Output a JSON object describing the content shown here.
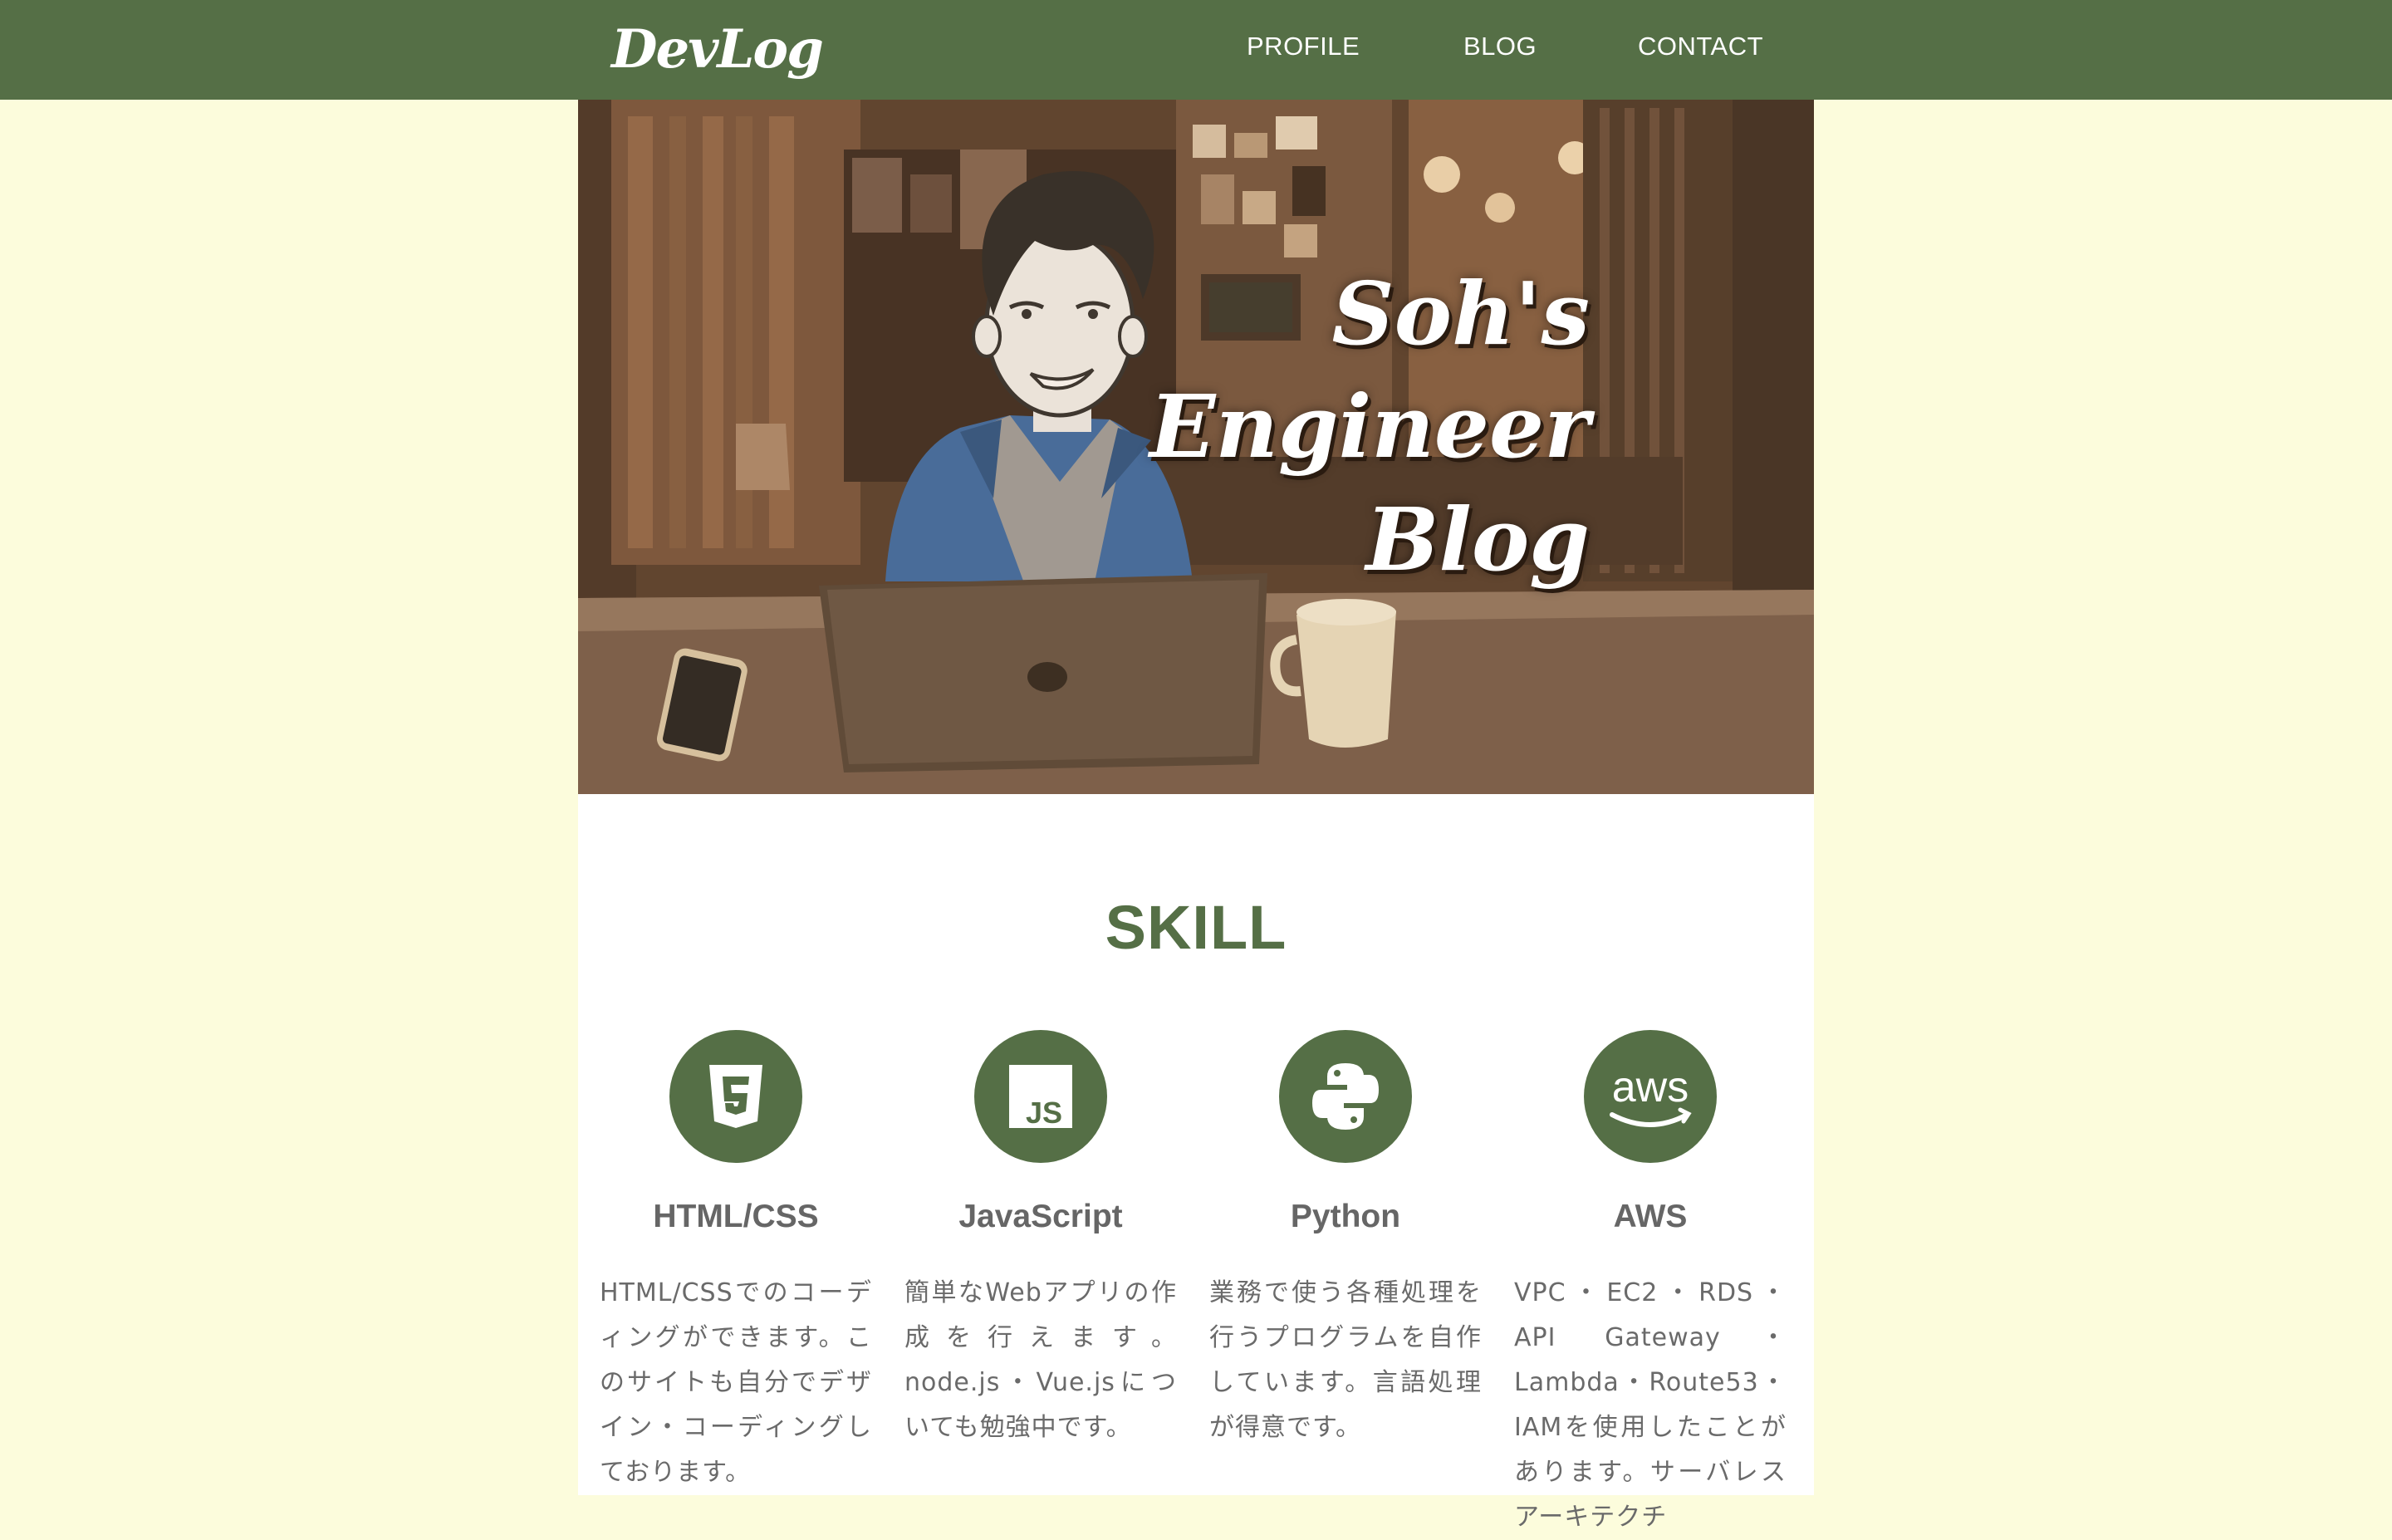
{
  "header": {
    "logo": "DevLog",
    "nav": [
      "PROFILE",
      "BLOG",
      "CONTACT"
    ]
  },
  "hero": {
    "title_lines": [
      "Soh's",
      "Engineer",
      "Blog"
    ]
  },
  "skills": {
    "title": "SKILL",
    "items": [
      {
        "icon": "html5-icon",
        "name": "HTML/CSS",
        "desc": "HTML/CSSでのコーディングができます。このサイトも自分でデザイン・コーディングしております。"
      },
      {
        "icon": "javascript-icon",
        "name": "JavaScript",
        "desc": "簡単なWebアプリの作成を行えます。node.js・Vue.jsについても勉強中です。"
      },
      {
        "icon": "python-icon",
        "name": "Python",
        "desc": "業務で使う各種処理を行うプログラムを自作しています。言語処理が得意です。"
      },
      {
        "icon": "aws-icon",
        "name": "AWS",
        "desc": "VPC・EC2・RDS・API Gateway・Lambda・Route53・IAMを使用したことがあります。サーバレスアーキテクチ"
      }
    ]
  },
  "colors": {
    "accent": "#556f46",
    "background": "#fcfcdc"
  }
}
